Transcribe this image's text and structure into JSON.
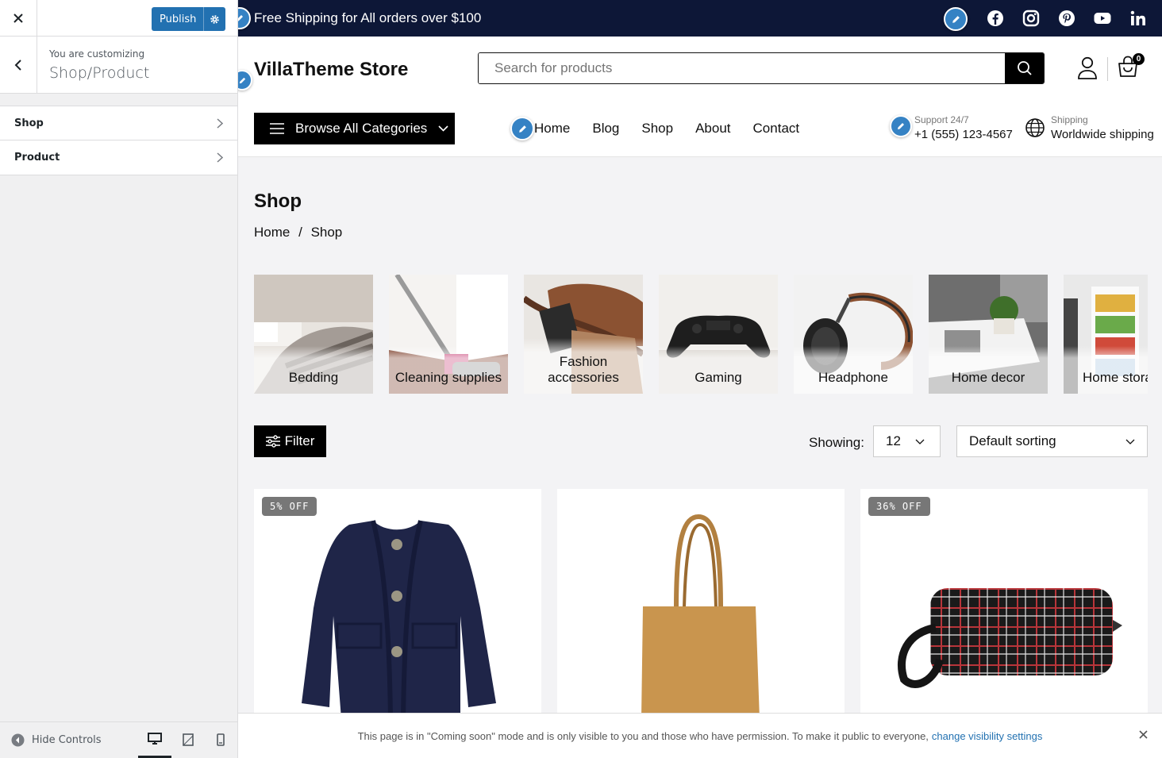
{
  "customizer": {
    "publish_label": "Publish",
    "you_are_customizing": "You are customizing",
    "customizing_title": "Shop/Product",
    "sections": [
      {
        "label": "Shop"
      },
      {
        "label": "Product"
      }
    ],
    "hide_controls_label": "Hide Controls"
  },
  "topbar": {
    "shipping_text": "Free Shipping for All orders over $100",
    "social": [
      "facebook-icon",
      "instagram-icon",
      "pinterest-icon",
      "youtube-icon",
      "linkedin-icon"
    ]
  },
  "header": {
    "logo": "VillaTheme Store",
    "search_placeholder": "Search for products",
    "cart_count": "0"
  },
  "nav": {
    "browse_label": "Browse All Categories",
    "menu": [
      "Home",
      "Blog",
      "Shop",
      "About",
      "Contact"
    ],
    "support_label": "Support 24/7",
    "support_phone": "+1 (555) 123-4567",
    "shipping_label": "Shipping",
    "shipping_value": "Worldwide shipping"
  },
  "page": {
    "title": "Shop",
    "breadcrumb": [
      "Home",
      "Shop"
    ],
    "breadcrumb_sep": "/"
  },
  "categories": [
    {
      "name": "Bedding"
    },
    {
      "name": "Cleaning supplies"
    },
    {
      "name": "Fashion accessories"
    },
    {
      "name": "Gaming"
    },
    {
      "name": "Headphone"
    },
    {
      "name": "Home decor"
    },
    {
      "name": "Home stora"
    }
  ],
  "toolbar": {
    "filter_label": "Filter",
    "showing_label": "Showing:",
    "per_page": "12",
    "sorting": "Default sorting"
  },
  "products": [
    {
      "badge": "5% OFF"
    },
    {
      "badge": ""
    },
    {
      "badge": "36% OFF"
    }
  ],
  "notice": {
    "text": "This page is in \"Coming soon\" mode and is only visible to you and those who have permission. To make it public to everyone,",
    "link": "change visibility settings"
  },
  "colors": {
    "topbar_bg": "#0d1737",
    "publish_blue": "#2271b1",
    "badge_gray": "#777777"
  }
}
